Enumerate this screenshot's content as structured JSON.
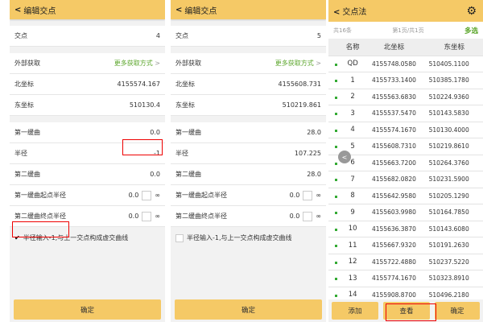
{
  "panel1": {
    "title": "编辑交点",
    "rows": {
      "point_label": "交点",
      "point": "4",
      "external_label": "外部获取",
      "more": "更多获取方式",
      "north_label": "北坐标",
      "north": "4155574.167",
      "east_label": "东坐标",
      "east": "510130.4",
      "spiral1_label": "第一缓曲",
      "spiral1": "0.0",
      "radius_label": "半径",
      "radius": "-1",
      "spiral2_label": "第二缓曲",
      "spiral2": "0.0",
      "start_r_label": "第一缓曲起点半径",
      "start_r": "0.0",
      "end_r_label": "第二缓曲终点半径",
      "end_r": "0.0",
      "inf": "∞"
    },
    "checkbox_label": "半径输入-1,与上一交点构成虚交曲线",
    "checked": true,
    "confirm": "确定"
  },
  "panel2": {
    "title": "编辑交点",
    "rows": {
      "point_label": "交点",
      "point": "5",
      "external_label": "外部获取",
      "more": "更多获取方式",
      "north_label": "北坐标",
      "north": "4155608.731",
      "east_label": "东坐标",
      "east": "510219.861",
      "spiral1_label": "第一缓曲",
      "spiral1": "28.0",
      "radius_label": "半径",
      "radius": "107.225",
      "spiral2_label": "第二缓曲",
      "spiral2": "28.0",
      "start_r_label": "第一缓曲起点半径",
      "start_r": "0.0",
      "end_r_label": "第二缓曲终点半径",
      "end_r": "0.0",
      "inf": "∞"
    },
    "checkbox_label": "半径输入-1,与上一交点构成虚交曲线",
    "checked": false,
    "confirm": "确定"
  },
  "panel3": {
    "title": "交点法",
    "count": "共16条",
    "page": "第1页/共1页",
    "multi": "多选",
    "columns": [
      "名称",
      "北坐标",
      "东坐标"
    ],
    "rows": [
      [
        "QD",
        "4155748.0580",
        "510405.1100"
      ],
      [
        "1",
        "4155733.1400",
        "510385.1780"
      ],
      [
        "2",
        "4155563.6830",
        "510224.9360"
      ],
      [
        "3",
        "4155537.5470",
        "510143.5830"
      ],
      [
        "4",
        "4155574.1670",
        "510130.4000"
      ],
      [
        "5",
        "4155608.7310",
        "510219.8610"
      ],
      [
        "6",
        "4155663.7200",
        "510264.3760"
      ],
      [
        "7",
        "4155682.0820",
        "510231.5900"
      ],
      [
        "8",
        "4155642.9580",
        "510205.1290"
      ],
      [
        "9",
        "4155603.9980",
        "510164.7850"
      ],
      [
        "10",
        "4155636.3870",
        "510143.6080"
      ],
      [
        "11",
        "4155667.9320",
        "510191.2630"
      ],
      [
        "12",
        "4155722.4880",
        "510237.5220"
      ],
      [
        "13",
        "4155774.1670",
        "510323.8910"
      ],
      [
        "14",
        "4155908.8700",
        "510496.2180"
      ]
    ],
    "add": "添加",
    "view": "查看",
    "confirm": "确定"
  },
  "colors": {
    "header": "#f5c966",
    "accent_green": "#5aa529",
    "highlight": "#e00000"
  }
}
